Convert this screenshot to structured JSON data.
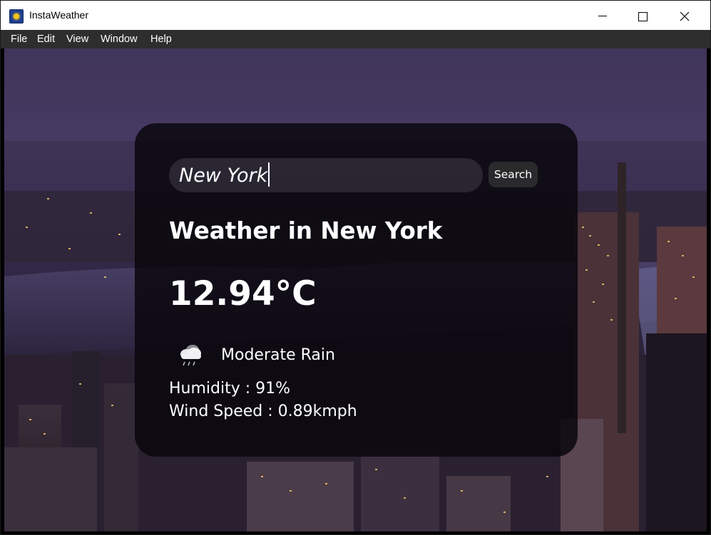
{
  "window": {
    "title": "InstaWeather"
  },
  "menu": [
    "File",
    "Edit",
    "View",
    "Window",
    "Help"
  ],
  "search": {
    "value": "New York",
    "button_label": "Search"
  },
  "weather": {
    "heading": "Weather in New York",
    "temperature": "12.94°C",
    "condition": "Moderate Rain",
    "condition_icon": "rain-cloud-icon",
    "humidity": "Humidity : 91%",
    "wind": "Wind Speed : 0.89kmph"
  },
  "colors": {
    "card_background": "#08060c",
    "menubar": "#2e2e2e",
    "text": "#ffffff"
  }
}
